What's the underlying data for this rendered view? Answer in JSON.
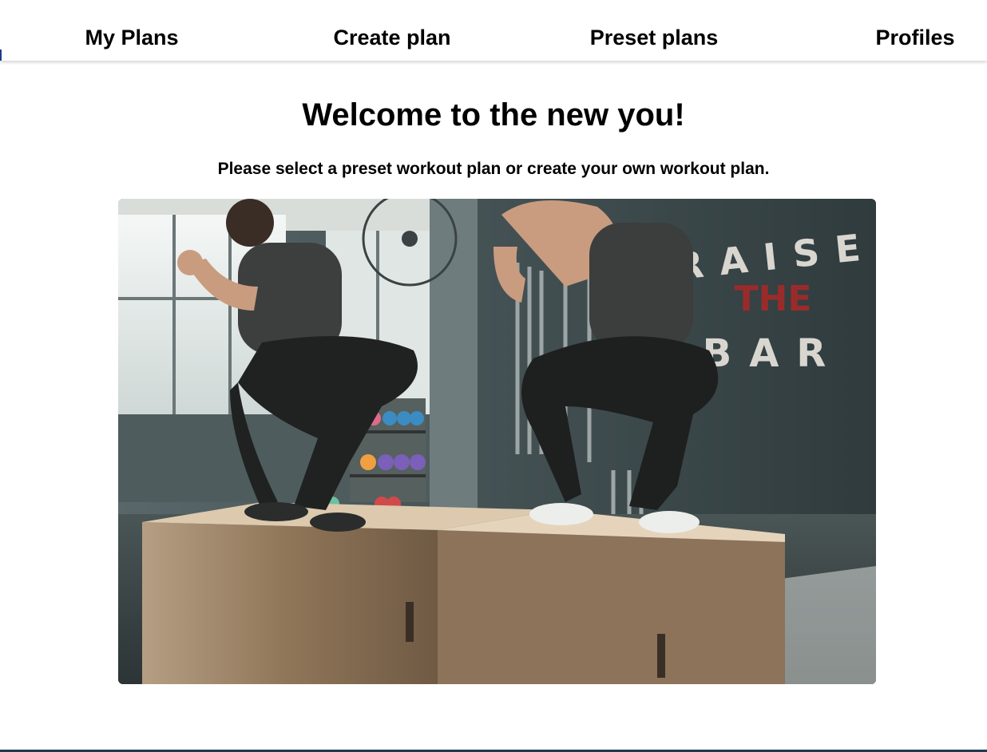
{
  "nav": {
    "items": [
      {
        "label": "My Plans",
        "id": "my-plans"
      },
      {
        "label": "Create plan",
        "id": "create-plan"
      },
      {
        "label": "Preset plans",
        "id": "preset-plans"
      },
      {
        "label": "Profiles",
        "id": "profiles"
      }
    ]
  },
  "main": {
    "title": "Welcome to the new you!",
    "subtitle": "Please select a preset workout plan or create your own workout plan."
  },
  "hero_image": {
    "wall_text_line1": "RAISE",
    "wall_text_line2": "THE",
    "wall_text_line3": "BAR"
  },
  "colors": {
    "nav_background": "#ffffff",
    "text": "#000000",
    "wall": "#3d4a4c",
    "accent_red": "#9a2b2b",
    "bottom_rule": "#1e3a4f"
  }
}
